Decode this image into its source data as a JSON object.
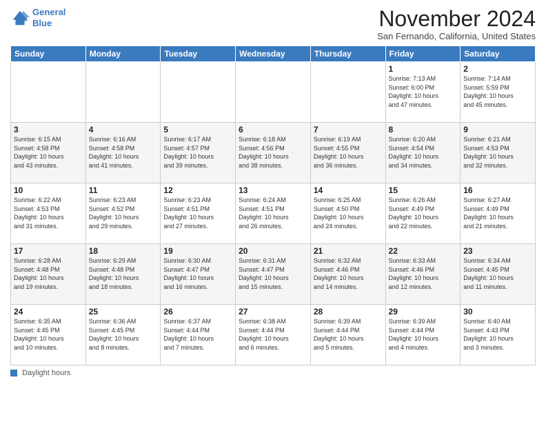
{
  "header": {
    "logo_line1": "General",
    "logo_line2": "Blue",
    "month": "November 2024",
    "location": "San Fernando, California, United States"
  },
  "weekdays": [
    "Sunday",
    "Monday",
    "Tuesday",
    "Wednesday",
    "Thursday",
    "Friday",
    "Saturday"
  ],
  "legend": "Daylight hours",
  "weeks": [
    [
      {
        "day": "",
        "info": ""
      },
      {
        "day": "",
        "info": ""
      },
      {
        "day": "",
        "info": ""
      },
      {
        "day": "",
        "info": ""
      },
      {
        "day": "",
        "info": ""
      },
      {
        "day": "1",
        "info": "Sunrise: 7:13 AM\nSunset: 6:00 PM\nDaylight: 10 hours\nand 47 minutes."
      },
      {
        "day": "2",
        "info": "Sunrise: 7:14 AM\nSunset: 5:59 PM\nDaylight: 10 hours\nand 45 minutes."
      }
    ],
    [
      {
        "day": "3",
        "info": "Sunrise: 6:15 AM\nSunset: 4:58 PM\nDaylight: 10 hours\nand 43 minutes."
      },
      {
        "day": "4",
        "info": "Sunrise: 6:16 AM\nSunset: 4:58 PM\nDaylight: 10 hours\nand 41 minutes."
      },
      {
        "day": "5",
        "info": "Sunrise: 6:17 AM\nSunset: 4:57 PM\nDaylight: 10 hours\nand 39 minutes."
      },
      {
        "day": "6",
        "info": "Sunrise: 6:18 AM\nSunset: 4:56 PM\nDaylight: 10 hours\nand 38 minutes."
      },
      {
        "day": "7",
        "info": "Sunrise: 6:19 AM\nSunset: 4:55 PM\nDaylight: 10 hours\nand 36 minutes."
      },
      {
        "day": "8",
        "info": "Sunrise: 6:20 AM\nSunset: 4:54 PM\nDaylight: 10 hours\nand 34 minutes."
      },
      {
        "day": "9",
        "info": "Sunrise: 6:21 AM\nSunset: 4:53 PM\nDaylight: 10 hours\nand 32 minutes."
      }
    ],
    [
      {
        "day": "10",
        "info": "Sunrise: 6:22 AM\nSunset: 4:53 PM\nDaylight: 10 hours\nand 31 minutes."
      },
      {
        "day": "11",
        "info": "Sunrise: 6:23 AM\nSunset: 4:52 PM\nDaylight: 10 hours\nand 29 minutes."
      },
      {
        "day": "12",
        "info": "Sunrise: 6:23 AM\nSunset: 4:51 PM\nDaylight: 10 hours\nand 27 minutes."
      },
      {
        "day": "13",
        "info": "Sunrise: 6:24 AM\nSunset: 4:51 PM\nDaylight: 10 hours\nand 26 minutes."
      },
      {
        "day": "14",
        "info": "Sunrise: 6:25 AM\nSunset: 4:50 PM\nDaylight: 10 hours\nand 24 minutes."
      },
      {
        "day": "15",
        "info": "Sunrise: 6:26 AM\nSunset: 4:49 PM\nDaylight: 10 hours\nand 22 minutes."
      },
      {
        "day": "16",
        "info": "Sunrise: 6:27 AM\nSunset: 4:49 PM\nDaylight: 10 hours\nand 21 minutes."
      }
    ],
    [
      {
        "day": "17",
        "info": "Sunrise: 6:28 AM\nSunset: 4:48 PM\nDaylight: 10 hours\nand 19 minutes."
      },
      {
        "day": "18",
        "info": "Sunrise: 6:29 AM\nSunset: 4:48 PM\nDaylight: 10 hours\nand 18 minutes."
      },
      {
        "day": "19",
        "info": "Sunrise: 6:30 AM\nSunset: 4:47 PM\nDaylight: 10 hours\nand 16 minutes."
      },
      {
        "day": "20",
        "info": "Sunrise: 6:31 AM\nSunset: 4:47 PM\nDaylight: 10 hours\nand 15 minutes."
      },
      {
        "day": "21",
        "info": "Sunrise: 6:32 AM\nSunset: 4:46 PM\nDaylight: 10 hours\nand 14 minutes."
      },
      {
        "day": "22",
        "info": "Sunrise: 6:33 AM\nSunset: 4:46 PM\nDaylight: 10 hours\nand 12 minutes."
      },
      {
        "day": "23",
        "info": "Sunrise: 6:34 AM\nSunset: 4:45 PM\nDaylight: 10 hours\nand 11 minutes."
      }
    ],
    [
      {
        "day": "24",
        "info": "Sunrise: 6:35 AM\nSunset: 4:45 PM\nDaylight: 10 hours\nand 10 minutes."
      },
      {
        "day": "25",
        "info": "Sunrise: 6:36 AM\nSunset: 4:45 PM\nDaylight: 10 hours\nand 8 minutes."
      },
      {
        "day": "26",
        "info": "Sunrise: 6:37 AM\nSunset: 4:44 PM\nDaylight: 10 hours\nand 7 minutes."
      },
      {
        "day": "27",
        "info": "Sunrise: 6:38 AM\nSunset: 4:44 PM\nDaylight: 10 hours\nand 6 minutes."
      },
      {
        "day": "28",
        "info": "Sunrise: 6:39 AM\nSunset: 4:44 PM\nDaylight: 10 hours\nand 5 minutes."
      },
      {
        "day": "29",
        "info": "Sunrise: 6:39 AM\nSunset: 4:44 PM\nDaylight: 10 hours\nand 4 minutes."
      },
      {
        "day": "30",
        "info": "Sunrise: 6:40 AM\nSunset: 4:43 PM\nDaylight: 10 hours\nand 3 minutes."
      }
    ]
  ]
}
